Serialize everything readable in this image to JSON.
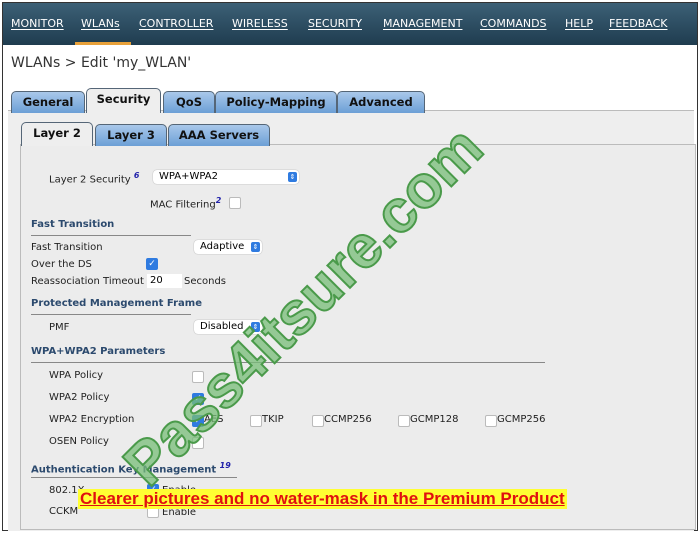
{
  "nav": [
    "MONITOR",
    "WLANs",
    "CONTROLLER",
    "WIRELESS",
    "SECURITY",
    "MANAGEMENT",
    "COMMANDS",
    "HELP",
    "FEEDBACK"
  ],
  "nav_active": "WLANs",
  "breadcrumb": "WLANs > Edit  'my_WLAN'",
  "tabs": [
    "General",
    "Security",
    "QoS",
    "Policy-Mapping",
    "Advanced"
  ],
  "subtabs": [
    "Layer 2",
    "Layer 3",
    "AAA Servers"
  ],
  "layer2": {
    "security_label": "Layer 2 Security",
    "security_help": "6",
    "security_value": "WPA+WPA2",
    "mac_label": "MAC Filtering",
    "mac_help": "2",
    "mac_checked": false
  },
  "fast_transition": {
    "heading": "Fast Transition",
    "ft_label": "Fast Transition",
    "ft_value": "Adaptive",
    "ds_label": "Over the DS",
    "ds_checked": true,
    "reassoc_label": "Reassociation Timeout",
    "reassoc_value": "20",
    "reassoc_unit": "Seconds"
  },
  "pmf": {
    "heading": "Protected Management Frame",
    "label": "PMF",
    "value": "Disabled"
  },
  "wpa": {
    "heading": "WPA+WPA2 Parameters",
    "wpa_policy": "WPA Policy",
    "wpa2_policy": "WPA2 Policy",
    "wpa2_enc": "WPA2 Encryption",
    "enc_options": [
      "AES",
      "TKIP",
      "CCMP256",
      "GCMP128",
      "GCMP256"
    ],
    "osen": "OSEN Policy"
  },
  "akm": {
    "heading": "Authentication Key Management",
    "help": "19",
    "dot1x": "802.1X",
    "dot1x_enable": "Enable",
    "cckm": "CCKM",
    "cckm_enable": "Enable"
  },
  "watermark": "Pass4itsure.com",
  "banner": "Clearer pictures and no water-mask in the Premium Product",
  "accent": "#2f7be0"
}
